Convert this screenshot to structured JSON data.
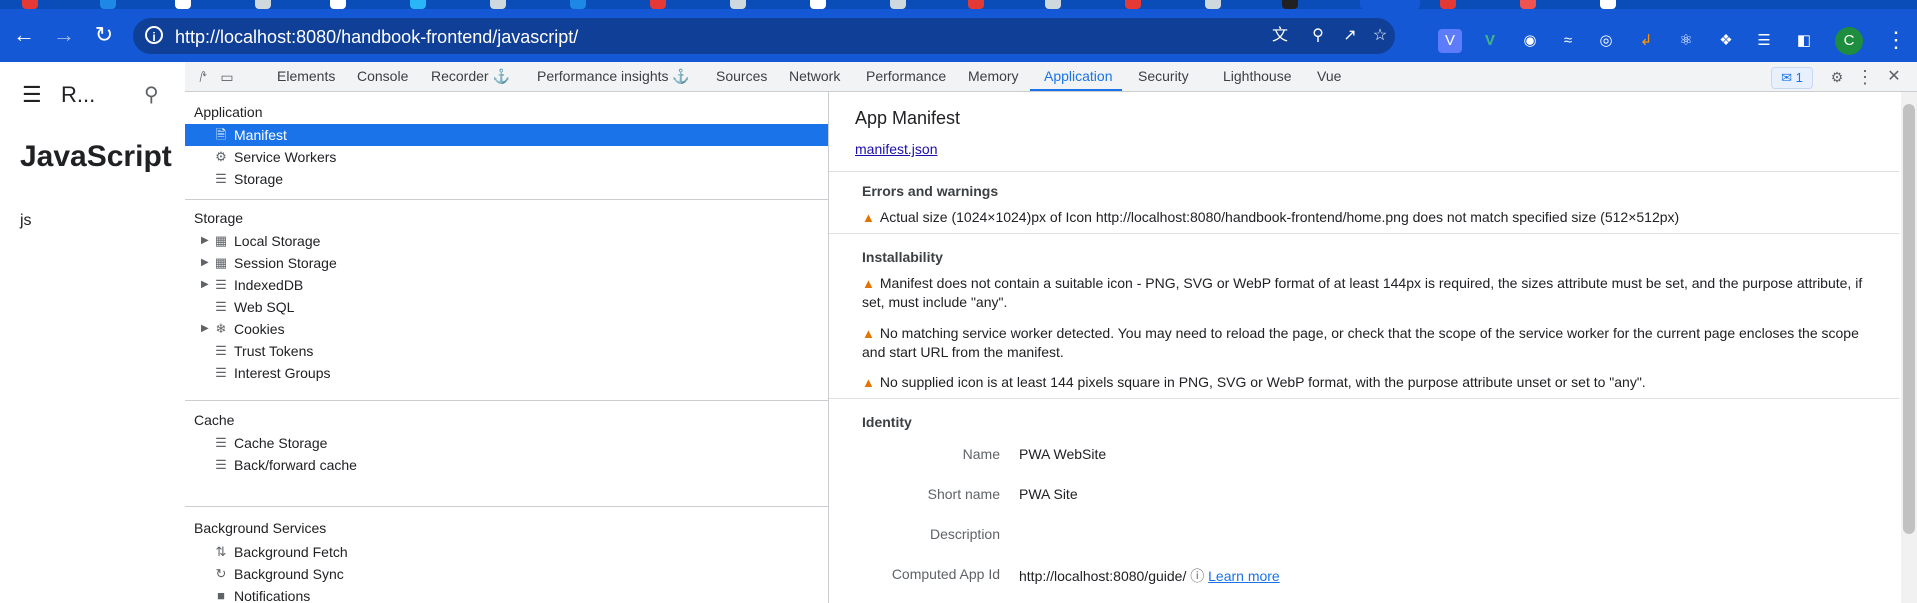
{
  "browser": {
    "url": "http://localhost:8080/handbook-frontend/javascript/",
    "avatar_letter": "C"
  },
  "page": {
    "site_title": "R...",
    "heading": "JavaScript",
    "text": "js"
  },
  "devtools": {
    "tabs": [
      "Elements",
      "Console",
      "Recorder",
      "Performance insights",
      "Sources",
      "Network",
      "Performance",
      "Memory",
      "Application",
      "Security",
      "Lighthouse",
      "Vue"
    ],
    "active_tab": "Application",
    "issues_count": "1",
    "sidebar": {
      "application_header": "Application",
      "application_items": [
        "Manifest",
        "Service Workers",
        "Storage"
      ],
      "storage_header": "Storage",
      "storage_items": [
        "Local Storage",
        "Session Storage",
        "IndexedDB",
        "Web SQL",
        "Cookies",
        "Trust Tokens",
        "Interest Groups"
      ],
      "cache_header": "Cache",
      "cache_items": [
        "Cache Storage",
        "Back/forward cache"
      ],
      "background_header": "Background Services",
      "background_items": [
        "Background Fetch",
        "Background Sync",
        "Notifications"
      ]
    },
    "manifest": {
      "title": "App Manifest",
      "link": "manifest.json",
      "errors_title": "Errors and warnings",
      "errors": [
        "Actual size (1024×1024)px of Icon http://localhost:8080/handbook-frontend/home.png does not match specified size (512×512px)"
      ],
      "installability_title": "Installability",
      "installability": [
        "Manifest does not contain a suitable icon - PNG, SVG or WebP format of at least 144px is required, the sizes attribute must be set, and the purpose attribute, if set, must include \"any\".",
        "No matching service worker detected. You may need to reload the page, or check that the scope of the service worker for the current page encloses the scope and start URL from the manifest.",
        "No supplied icon is at least 144 pixels square in PNG, SVG or WebP format, with the purpose attribute unset or set to \"any\"."
      ],
      "identity_title": "Identity",
      "identity": {
        "name_label": "Name",
        "name_value": "PWA WebSite",
        "short_label": "Short name",
        "short_value": "PWA Site",
        "desc_label": "Description",
        "desc_value": "",
        "computed_label": "Computed App Id",
        "computed_value": "http://localhost:8080/guide/",
        "learn_more": "Learn more"
      }
    }
  },
  "colors": {
    "chrome_blue": "#1558d6",
    "accent": "#1a73e8",
    "warning": "#e37400"
  }
}
